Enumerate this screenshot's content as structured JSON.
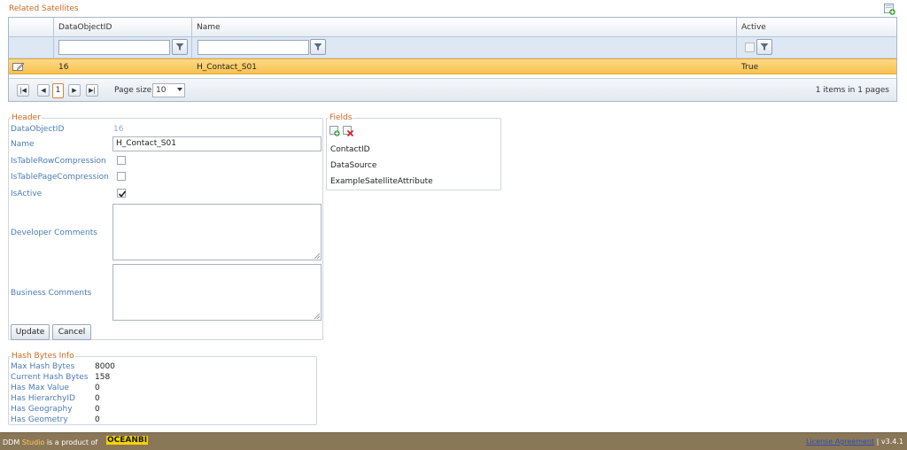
{
  "section_title": "Related Satellites",
  "grid": {
    "columns": [
      "DataObjectID",
      "Name",
      "Active"
    ],
    "row": {
      "dataobjectid": "16",
      "name": "H_Contact_S01",
      "active": "True"
    },
    "pager": {
      "current_page": "1",
      "page_size_label": "Page size:",
      "page_size": "10",
      "info": "1 items in 1 pages"
    }
  },
  "header_form": {
    "legend": "Header",
    "dataobjectid_label": "DataObjectID",
    "dataobjectid_value": "16",
    "name_label": "Name",
    "name_value": "H_Contact_S01",
    "row_compression_label": "IsTableRowCompression",
    "page_compression_label": "IsTablePageCompression",
    "is_active_label": "IsActive",
    "is_active": true,
    "dev_comments_label": "Developer Comments",
    "business_comments_label": "Business Comments",
    "update_label": "Update",
    "cancel_label": "Cancel"
  },
  "fields": {
    "legend": "Fields",
    "items": [
      "ContactID",
      "DataSource",
      "ExampleSatelliteAttribute"
    ]
  },
  "hash_info": {
    "legend": "Hash Bytes Info",
    "rows": [
      {
        "label": "Max Hash Bytes",
        "value": "8000"
      },
      {
        "label": "Current Hash Bytes",
        "value": "158"
      },
      {
        "label": "Has Max Value",
        "value": "0"
      },
      {
        "label": "Has HierarchyID",
        "value": "0"
      },
      {
        "label": "Has Geography",
        "value": "0"
      },
      {
        "label": "Has Geometry",
        "value": "0"
      }
    ]
  },
  "footer": {
    "product_prefix": "DDM",
    "product_brand": "Studio",
    "product_suffix": "is a product of",
    "logo_text": "OCEANBI",
    "license_label": "License Agreement",
    "version": "| v3.4.1"
  }
}
